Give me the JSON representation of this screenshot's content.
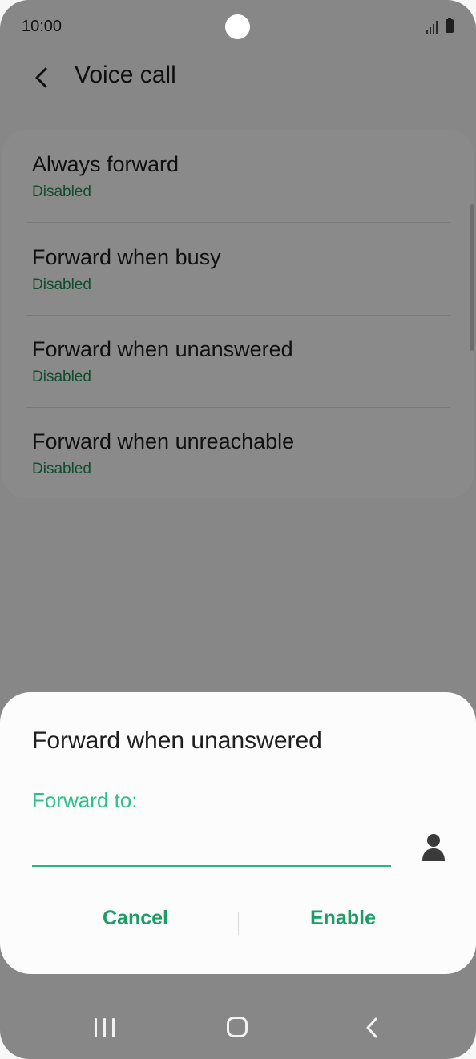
{
  "status_bar": {
    "time": "10:00"
  },
  "header": {
    "title": "Voice call",
    "back_icon": "chevron-left-icon"
  },
  "list": {
    "items": [
      {
        "title": "Always forward",
        "status": "Disabled"
      },
      {
        "title": "Forward when busy",
        "status": "Disabled"
      },
      {
        "title": "Forward when unanswered",
        "status": "Disabled"
      },
      {
        "title": "Forward when unreachable",
        "status": "Disabled"
      }
    ]
  },
  "dialog": {
    "title": "Forward when unanswered",
    "field_label": "Forward to:",
    "field_value": "",
    "contact_icon": "person-icon",
    "cancel_label": "Cancel",
    "enable_label": "Enable"
  },
  "colors": {
    "accent": "#2cbf86",
    "status_green": "#1f8a56",
    "button_green": "#1c9d68"
  },
  "nav_bar": {
    "recent_icon": "recent-apps-icon",
    "home_icon": "home-icon",
    "back_icon": "back-icon"
  }
}
